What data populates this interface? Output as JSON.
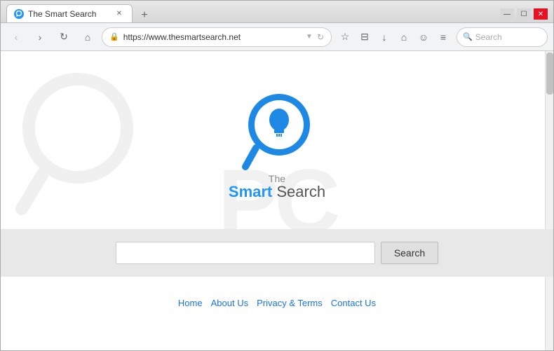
{
  "browser": {
    "title": "The Smart Search",
    "url": "https://www.thesmartsearch.net",
    "tab_label": "The Smart Search"
  },
  "nav": {
    "back_label": "‹",
    "forward_label": "›",
    "refresh_label": "↻",
    "home_label": "⌂",
    "search_placeholder": "Search",
    "menu_label": "≡",
    "bookmark_label": "☆",
    "download_label": "↓",
    "smiley_label": "☺"
  },
  "logo": {
    "the_label": "The",
    "smart_label": "Smart",
    "search_label": "Search"
  },
  "search": {
    "button_label": "Search",
    "input_placeholder": ""
  },
  "footer": {
    "home_label": "Home",
    "about_label": "About Us",
    "privacy_label": "Privacy & Terms",
    "contact_label": "Contact Us"
  },
  "watermark": {
    "text": "PC"
  }
}
